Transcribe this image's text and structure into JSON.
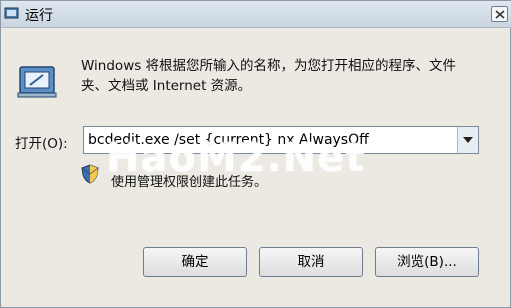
{
  "window": {
    "title": "运行",
    "title_icon": "run-dialog-icon",
    "close_icon": "close-icon"
  },
  "main": {
    "icon": "run-program-icon",
    "description": "Windows 将根据您所输入的名称，为您打开相应的程序、文件夹、文档或 Internet 资源。",
    "open_label": "打开(O):",
    "command_value": "bcdedit.exe /set {current} nx AlwaysOff",
    "dropdown_icon": "chevron-down-icon",
    "shield_icon": "uac-shield-icon",
    "admin_note": "使用管理权限创建此任务。"
  },
  "buttons": {
    "ok": "确定",
    "cancel": "取消",
    "browse": "浏览(B)..."
  },
  "watermark": {
    "text": "HaoM2.Net"
  },
  "colors": {
    "dialog_bg": "#ece9e3",
    "titlebar": "#c9d5e1",
    "border": "#6f7f90"
  }
}
